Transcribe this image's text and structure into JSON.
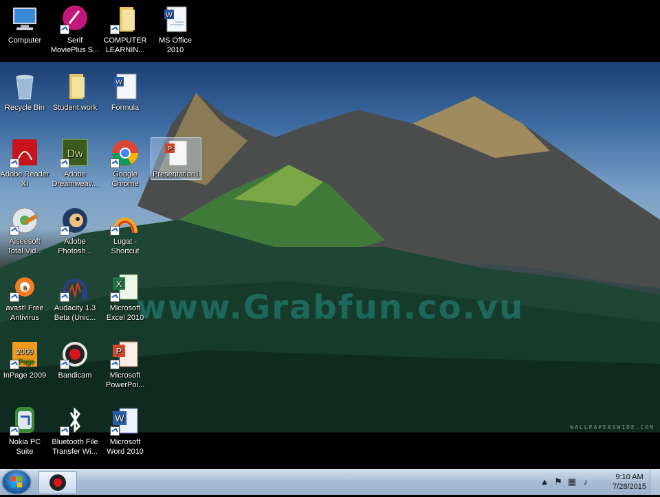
{
  "desktop": {
    "watermark": "www.Grabfun.co.vu",
    "wallpaper_credit": "WALLPAPERSWIDE.COM",
    "icons": [
      {
        "label": "Computer",
        "icon": "computer-icon"
      },
      {
        "label": "Serif\nMoviePlus S...",
        "icon": "serif-movieplus-icon"
      },
      {
        "label": "COMPUTER\nLEARNIN...",
        "icon": "folder-icon"
      },
      {
        "label": "MS Office\n2010",
        "icon": "word-doc-icon"
      },
      {
        "label": "Recycle Bin",
        "icon": "recycle-bin-icon"
      },
      {
        "label": "Student work",
        "icon": "folder-icon"
      },
      {
        "label": "Formula",
        "icon": "word-doc-icon"
      },
      {
        "label": "Adobe Reader\nXI",
        "icon": "adobe-reader-icon"
      },
      {
        "label": "Adobe\nDreamweav...",
        "icon": "dreamweaver-icon"
      },
      {
        "label": "Google\nChrome",
        "icon": "chrome-icon"
      },
      {
        "label": "Presentation1",
        "icon": "powerpoint-file-icon"
      },
      {
        "label": "Aiseesoft\nTotal Vid...",
        "icon": "aiseesoft-icon"
      },
      {
        "label": "Adobe\nPhotosh...",
        "icon": "photoshop-icon"
      },
      {
        "label": "Lugat -\nShortcut",
        "icon": "lugat-icon"
      },
      {
        "label": "avast! Free\nAntivirus",
        "icon": "avast-icon"
      },
      {
        "label": "Audacity 1.3\nBeta (Unic...",
        "icon": "audacity-icon"
      },
      {
        "label": "Microsoft\nExcel 2010",
        "icon": "excel-icon"
      },
      {
        "label": "InPage 2009",
        "icon": "inpage-icon"
      },
      {
        "label": "Bandicam",
        "icon": "bandicam-icon"
      },
      {
        "label": "Microsoft\nPowerPoi...",
        "icon": "powerpoint-icon"
      },
      {
        "label": "Nokia PC\nSuite",
        "icon": "nokia-pc-suite-icon"
      },
      {
        "label": "Bluetooth File\nTransfer Wi...",
        "icon": "bluetooth-icon"
      },
      {
        "label": "Microsoft\nWord 2010",
        "icon": "word-icon"
      }
    ]
  },
  "taskbar": {
    "clock_time": "9:10 AM",
    "clock_date": "7/28/2015",
    "tray_icons": [
      "show-hidden-icons-arrow",
      "action-center-flag-icon",
      "network-icon",
      "volume-icon"
    ]
  }
}
